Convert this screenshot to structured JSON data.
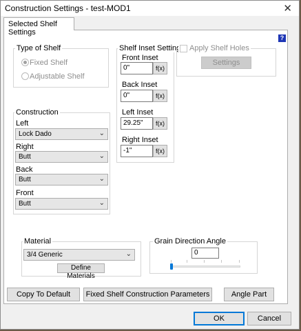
{
  "window": {
    "title": "Construction Settings - test-MOD1",
    "close_glyph": "✕"
  },
  "tab": {
    "label": "Selected Shelf Settings"
  },
  "help_glyph": "?",
  "type_of_shelf": {
    "label": "Type of Shelf",
    "options": [
      {
        "label": "Fixed Shelf",
        "selected": true
      },
      {
        "label": "Adjustable Shelf",
        "selected": false
      }
    ]
  },
  "construction": {
    "label": "Construction",
    "fields": [
      {
        "label": "Left",
        "value": "Lock Dado"
      },
      {
        "label": "Right",
        "value": "Butt"
      },
      {
        "label": "Back",
        "value": "Butt"
      },
      {
        "label": "Front",
        "value": "Butt"
      }
    ]
  },
  "shelf_inset": {
    "label": "Shelf Inset Settings",
    "fields": [
      {
        "label": "Front Inset",
        "value": "0\""
      },
      {
        "label": "Back Inset",
        "value": "0\""
      },
      {
        "label": "Left Inset",
        "value": "29.25\""
      },
      {
        "label": "Right Inset",
        "value": "-1\""
      }
    ],
    "fx_label": "f(x)"
  },
  "apply_shelf_holes": {
    "label": "Apply Shelf Holes",
    "checked": false,
    "settings_label": "Settings"
  },
  "material": {
    "label": "Material",
    "value": "3/4 Generic",
    "define_label": "Define Materials"
  },
  "grain": {
    "label": "Grain Direction Angle",
    "value": "0",
    "level": 0
  },
  "actions": {
    "copy_default": "Copy To Default",
    "fixed_params": "Fixed Shelf Construction Parameters",
    "angle_part": "Angle Part"
  },
  "footer": {
    "ok": "OK",
    "cancel": "Cancel"
  }
}
